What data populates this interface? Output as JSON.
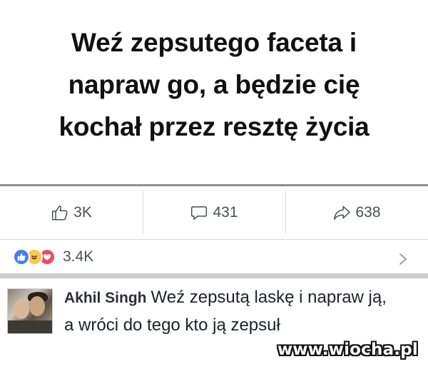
{
  "post": {
    "lines": [
      "Weź zepsutego faceta i",
      "napraw go, a będzie cię",
      "kochał przez resztę życia"
    ]
  },
  "actions": {
    "likes": "3K",
    "comments": "431",
    "shares": "638"
  },
  "reactions": {
    "icons": [
      "like-icon",
      "haha-icon",
      "love-icon"
    ],
    "count": "3.4K"
  },
  "comment": {
    "author": "Akhil Singh",
    "text": "Weź zepsutą laskę i napraw ją, a wróci do tego kto ją zepsuł"
  },
  "watermark": "www.wiocha.pl",
  "colors": {
    "like": "#4a7cf0",
    "haha": "#f7c94a",
    "love": "#ee4a6b",
    "divider": "#c9ccd1"
  }
}
